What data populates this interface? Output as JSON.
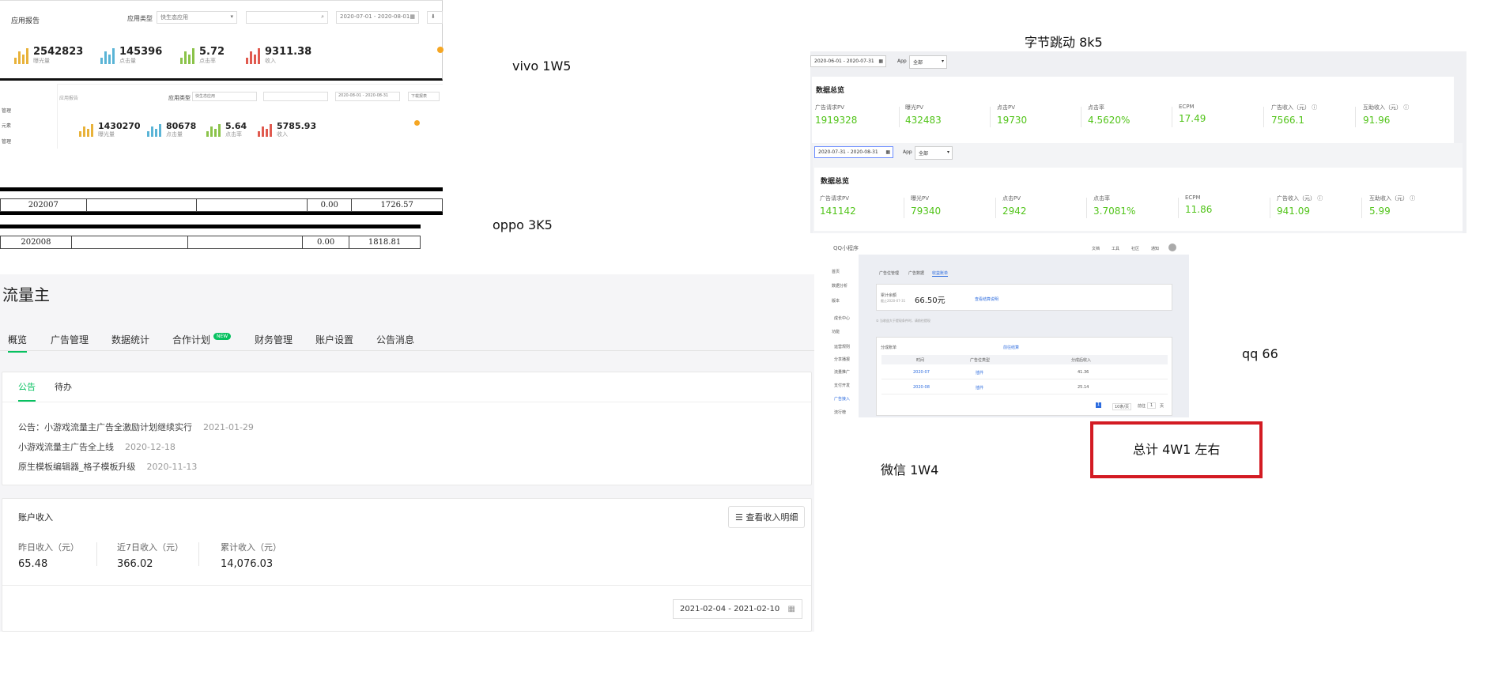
{
  "notes": {
    "vivo": "vivo 1W5",
    "oppo": "oppo 3K5",
    "bytedance": "字节跳动 8k5",
    "qq": "qq 66",
    "wechat": "微信 1W4",
    "total": "总计 4W1 左右"
  },
  "vivo": {
    "title": "应用报告",
    "app_type_label": "应用类型",
    "app_type_value": "快生态应用",
    "date_range": "2020-07-01 - 2020-08-01",
    "stats": [
      {
        "value": "2542823",
        "label": "曝光量",
        "color": "#e8b23a"
      },
      {
        "value": "145396",
        "label": "点击量",
        "color": "#5ab4d6"
      },
      {
        "value": "5.72",
        "label": "点击率",
        "color": "#8bc34a"
      },
      {
        "value": "9311.38",
        "label": "收入",
        "color": "#e05a4f"
      }
    ],
    "second": {
      "title": "应用报告",
      "app_type_label": "应用类型",
      "app_type_value": "快生态应用",
      "date_range": "2020-08-01 - 2020-08-31",
      "download": "下载报表",
      "menu": [
        "管理",
        "元素",
        "管理"
      ],
      "stats": [
        {
          "value": "1430270",
          "label": "曝光量",
          "color": "#e8b23a"
        },
        {
          "value": "80678",
          "label": "点击量",
          "color": "#5ab4d6"
        },
        {
          "value": "5.64",
          "label": "点击率",
          "color": "#8bc34a"
        },
        {
          "value": "5785.93",
          "label": "收入",
          "color": "#e05a4f"
        }
      ]
    }
  },
  "oppo_tables": [
    {
      "month": "202007",
      "c4": "0.00",
      "c5": "1726.57"
    },
    {
      "month": "202008",
      "c4": "0.00",
      "c5": "1818.81"
    }
  ],
  "llz": {
    "title": "流量主",
    "tabs": [
      "概览",
      "广告管理",
      "数据统计",
      "合作计划",
      "财务管理",
      "账户设置",
      "公告消息"
    ],
    "new_badge": "NEW",
    "subtabs": [
      "公告",
      "待办"
    ],
    "announcements": [
      {
        "text": "公告：小游戏流量主广告全激励计划继续实行",
        "date": "2021-01-29"
      },
      {
        "text": "小游戏流量主广告全上线",
        "date": "2020-12-18"
      },
      {
        "text": "原生模板编辑器_格子模板升级",
        "date": "2020-11-13"
      }
    ],
    "income_title": "账户收入",
    "income_button": "查看收入明细",
    "income": [
      {
        "label": "昨日收入（元）",
        "value": "65.48"
      },
      {
        "label": "近7日收入（元）",
        "value": "366.02"
      },
      {
        "label": "累计收入（元）",
        "value": "14,076.03"
      }
    ],
    "date_range": "2021-02-04 - 2021-02-10"
  },
  "bytedance": {
    "panels": [
      {
        "date_range": "2020-06-01 - 2020-07-31",
        "app_label": "App",
        "app_value": "全部",
        "heading": "数据总览",
        "metrics": [
          {
            "label": "广告请求PV",
            "value": "1919328"
          },
          {
            "label": "曝光PV",
            "value": "432483"
          },
          {
            "label": "点击PV",
            "value": "19730"
          },
          {
            "label": "点击率",
            "value": "4.5620%"
          },
          {
            "label": "ECPM",
            "value": "17.49"
          },
          {
            "label": "广告收入（元）",
            "value": "7566.1"
          },
          {
            "label": "互助收入（元）",
            "value": "91.96"
          }
        ]
      },
      {
        "date_range": "2020-07-31 - 2020-08-31",
        "app_label": "App",
        "app_value": "全部",
        "heading": "数据总览",
        "metrics": [
          {
            "label": "广告请求PV",
            "value": "141142"
          },
          {
            "label": "曝光PV",
            "value": "79340"
          },
          {
            "label": "点击PV",
            "value": "2942"
          },
          {
            "label": "点击率",
            "value": "3.7081%"
          },
          {
            "label": "ECPM",
            "value": "11.86"
          },
          {
            "label": "广告收入（元）",
            "value": "941.09"
          },
          {
            "label": "互助收入（元）",
            "value": "5.99"
          }
        ]
      }
    ]
  },
  "qq": {
    "title": "QQ小程序",
    "top_links": [
      "文档",
      "工具",
      "社区",
      "通知"
    ],
    "side": [
      "首页",
      "数据分析",
      "版本",
      "成长中心",
      "功能",
      "运营规则",
      "分享播报",
      "流量推广",
      "支付开发",
      "广告接入",
      "流行榜"
    ],
    "tabs": [
      "广告位管理",
      "广告数据",
      "收益账单"
    ],
    "balance_label": "累计余额",
    "balance_sub": "截止2020-07-31",
    "balance_value": "66.50元",
    "balance_link": "查看结算说明",
    "note": "① 当收益大于提现条件时，请前往提现",
    "detail_title": "分成账单",
    "detail_link": "前往结算",
    "columns": [
      "时间",
      "广告位类型",
      "分成后收入"
    ],
    "rows": [
      {
        "time": "2020-07",
        "type": "插件",
        "income": "41.36"
      },
      {
        "time": "2020-08",
        "type": "插件",
        "income": "25.14"
      }
    ],
    "pager": {
      "page": "1",
      "size": "10条/页",
      "goto": "前往",
      "goto_value": "1",
      "unit": "页"
    }
  }
}
